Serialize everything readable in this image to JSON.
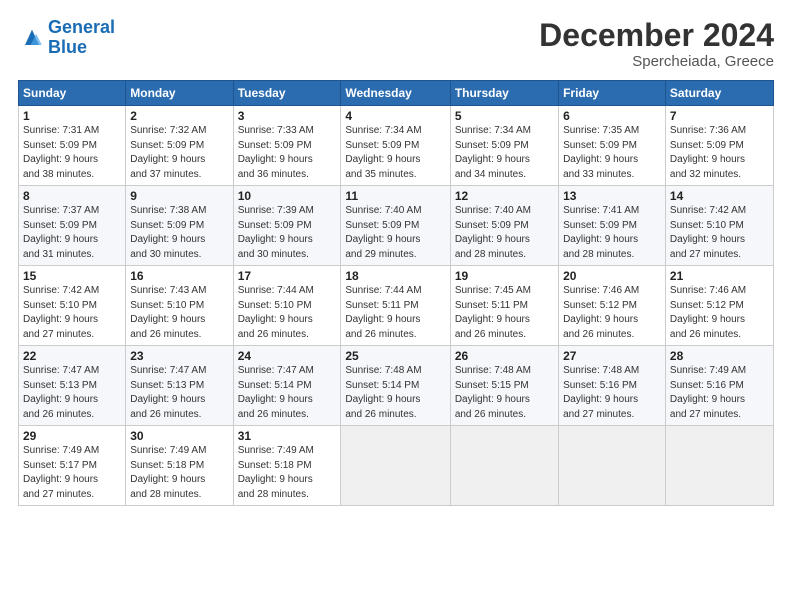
{
  "header": {
    "logo_line1": "General",
    "logo_line2": "Blue",
    "month_title": "December 2024",
    "location": "Spercheiada, Greece"
  },
  "weekdays": [
    "Sunday",
    "Monday",
    "Tuesday",
    "Wednesday",
    "Thursday",
    "Friday",
    "Saturday"
  ],
  "weeks": [
    [
      {
        "day": "1",
        "info": "Sunrise: 7:31 AM\nSunset: 5:09 PM\nDaylight: 9 hours\nand 38 minutes."
      },
      {
        "day": "2",
        "info": "Sunrise: 7:32 AM\nSunset: 5:09 PM\nDaylight: 9 hours\nand 37 minutes."
      },
      {
        "day": "3",
        "info": "Sunrise: 7:33 AM\nSunset: 5:09 PM\nDaylight: 9 hours\nand 36 minutes."
      },
      {
        "day": "4",
        "info": "Sunrise: 7:34 AM\nSunset: 5:09 PM\nDaylight: 9 hours\nand 35 minutes."
      },
      {
        "day": "5",
        "info": "Sunrise: 7:34 AM\nSunset: 5:09 PM\nDaylight: 9 hours\nand 34 minutes."
      },
      {
        "day": "6",
        "info": "Sunrise: 7:35 AM\nSunset: 5:09 PM\nDaylight: 9 hours\nand 33 minutes."
      },
      {
        "day": "7",
        "info": "Sunrise: 7:36 AM\nSunset: 5:09 PM\nDaylight: 9 hours\nand 32 minutes."
      }
    ],
    [
      {
        "day": "8",
        "info": "Sunrise: 7:37 AM\nSunset: 5:09 PM\nDaylight: 9 hours\nand 31 minutes."
      },
      {
        "day": "9",
        "info": "Sunrise: 7:38 AM\nSunset: 5:09 PM\nDaylight: 9 hours\nand 30 minutes."
      },
      {
        "day": "10",
        "info": "Sunrise: 7:39 AM\nSunset: 5:09 PM\nDaylight: 9 hours\nand 30 minutes."
      },
      {
        "day": "11",
        "info": "Sunrise: 7:40 AM\nSunset: 5:09 PM\nDaylight: 9 hours\nand 29 minutes."
      },
      {
        "day": "12",
        "info": "Sunrise: 7:40 AM\nSunset: 5:09 PM\nDaylight: 9 hours\nand 28 minutes."
      },
      {
        "day": "13",
        "info": "Sunrise: 7:41 AM\nSunset: 5:09 PM\nDaylight: 9 hours\nand 28 minutes."
      },
      {
        "day": "14",
        "info": "Sunrise: 7:42 AM\nSunset: 5:10 PM\nDaylight: 9 hours\nand 27 minutes."
      }
    ],
    [
      {
        "day": "15",
        "info": "Sunrise: 7:42 AM\nSunset: 5:10 PM\nDaylight: 9 hours\nand 27 minutes."
      },
      {
        "day": "16",
        "info": "Sunrise: 7:43 AM\nSunset: 5:10 PM\nDaylight: 9 hours\nand 26 minutes."
      },
      {
        "day": "17",
        "info": "Sunrise: 7:44 AM\nSunset: 5:10 PM\nDaylight: 9 hours\nand 26 minutes."
      },
      {
        "day": "18",
        "info": "Sunrise: 7:44 AM\nSunset: 5:11 PM\nDaylight: 9 hours\nand 26 minutes."
      },
      {
        "day": "19",
        "info": "Sunrise: 7:45 AM\nSunset: 5:11 PM\nDaylight: 9 hours\nand 26 minutes."
      },
      {
        "day": "20",
        "info": "Sunrise: 7:46 AM\nSunset: 5:12 PM\nDaylight: 9 hours\nand 26 minutes."
      },
      {
        "day": "21",
        "info": "Sunrise: 7:46 AM\nSunset: 5:12 PM\nDaylight: 9 hours\nand 26 minutes."
      }
    ],
    [
      {
        "day": "22",
        "info": "Sunrise: 7:47 AM\nSunset: 5:13 PM\nDaylight: 9 hours\nand 26 minutes."
      },
      {
        "day": "23",
        "info": "Sunrise: 7:47 AM\nSunset: 5:13 PM\nDaylight: 9 hours\nand 26 minutes."
      },
      {
        "day": "24",
        "info": "Sunrise: 7:47 AM\nSunset: 5:14 PM\nDaylight: 9 hours\nand 26 minutes."
      },
      {
        "day": "25",
        "info": "Sunrise: 7:48 AM\nSunset: 5:14 PM\nDaylight: 9 hours\nand 26 minutes."
      },
      {
        "day": "26",
        "info": "Sunrise: 7:48 AM\nSunset: 5:15 PM\nDaylight: 9 hours\nand 26 minutes."
      },
      {
        "day": "27",
        "info": "Sunrise: 7:48 AM\nSunset: 5:16 PM\nDaylight: 9 hours\nand 27 minutes."
      },
      {
        "day": "28",
        "info": "Sunrise: 7:49 AM\nSunset: 5:16 PM\nDaylight: 9 hours\nand 27 minutes."
      }
    ],
    [
      {
        "day": "29",
        "info": "Sunrise: 7:49 AM\nSunset: 5:17 PM\nDaylight: 9 hours\nand 27 minutes."
      },
      {
        "day": "30",
        "info": "Sunrise: 7:49 AM\nSunset: 5:18 PM\nDaylight: 9 hours\nand 28 minutes."
      },
      {
        "day": "31",
        "info": "Sunrise: 7:49 AM\nSunset: 5:18 PM\nDaylight: 9 hours\nand 28 minutes."
      },
      null,
      null,
      null,
      null
    ]
  ]
}
